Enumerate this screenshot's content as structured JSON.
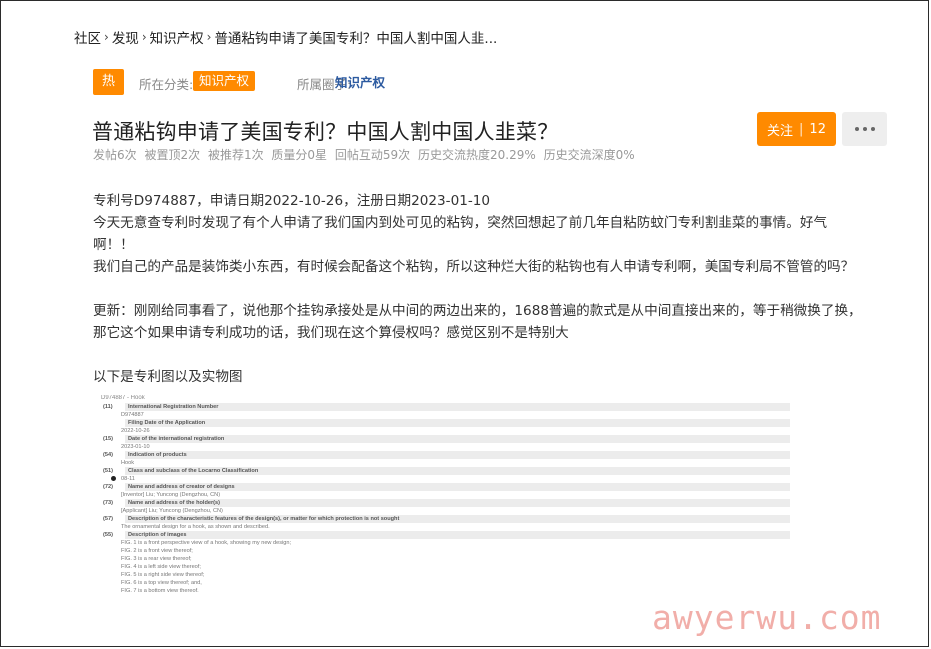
{
  "breadcrumb": {
    "items": [
      "社区",
      "发现",
      "知识产权",
      "普通粘钩申请了美国专利？中国人割中国人韭..."
    ],
    "separator": "›"
  },
  "meta": {
    "hot_badge": "热",
    "category_label": "所在分类:",
    "category_tag": "知识产权",
    "circle_label": "所属圈子:",
    "circle_link": "知识产权"
  },
  "post": {
    "title": "普通粘钩申请了美国专利？中国人割中国人韭菜？",
    "stats": [
      "发帖6次",
      "被置顶2次",
      "被推荐1次",
      "质量分0星",
      "回帖互动59次",
      "历史交流热度20.29%",
      "历史交流深度0%"
    ]
  },
  "actions": {
    "follow_label": "关注",
    "follow_sep": "|",
    "follow_count": "12"
  },
  "content": {
    "line1": "专利号D974887，申请日期2022-10-26，注册日期2023-01-10",
    "line2": "今天无意查专利时发现了有个人申请了我们国内到处可见的粘钩，突然回想起了前几年自粘防蚊门专利割韭菜的事情。好气",
    "line3": "啊！！",
    "line4": "我们自己的产品是装饰类小东西，有时候会配备这个粘钩，所以这种烂大街的粘钩也有人申请专利啊，美国专利局不管管的吗？",
    "line5": "更新：刚刚给同事看了，说他那个挂钩承接处是从中间的两边出来的，1688普遍的款式是从中间直接出来的，等于稍微换了换，",
    "line6": "那它这个如果申请专利成功的话，我们现在这个算侵权吗？感觉区别不是特别大",
    "line7": "以下是专利图以及实物图"
  },
  "patent": {
    "header": "D974887 - Hook",
    "rows": [
      {
        "num": "(11)",
        "label": "International Registration Number",
        "values": [
          "D974887"
        ]
      },
      {
        "num": "",
        "label": "Filing Date of the Application",
        "values": [
          "2022-10-26"
        ]
      },
      {
        "num": "(15)",
        "label": "Date of the international registration",
        "values": [
          "2023-01-10"
        ]
      },
      {
        "num": "(54)",
        "label": "Indication of products",
        "values": [
          "Hook"
        ]
      },
      {
        "num": "(51)",
        "label": "Class and subclass of the Locarno Classification",
        "values": [
          "08-11"
        ],
        "dot": true
      },
      {
        "num": "(72)",
        "label": "Name and address of creator of designs",
        "values": [
          "[Inventor] Liu; Yuncong (Dengzhou, CN)"
        ]
      },
      {
        "num": "(73)",
        "label": "Name and address of the holder(s)",
        "values": [
          "[Applicant] Liu; Yuncong (Dengzhou, CN)"
        ]
      },
      {
        "num": "(57)",
        "label": "Description of the characteristic features of the design(s), or matter for which protection is not sought",
        "values": [
          "The ornamental design for a hook, as shown and described."
        ]
      },
      {
        "num": "(55)",
        "label": "Description of images",
        "values": [
          "FIG. 1 is a front perspective view of a hook, showing my new design;",
          "FIG. 2 is a front view thereof;",
          "FIG. 3 is a rear view thereof;",
          "FIG. 4 is a left side view thereof;",
          "FIG. 5 is a right side view thereof;",
          "FIG. 6 is a top view thereof; and,",
          "FIG. 7 is a bottom view thereof."
        ]
      }
    ]
  },
  "watermark": "awyerwu.com"
}
